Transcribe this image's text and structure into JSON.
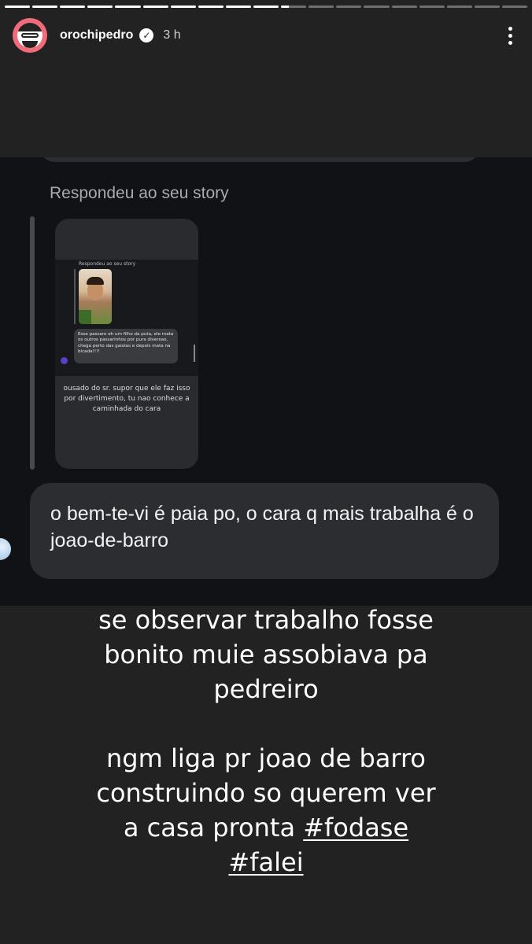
{
  "progress": {
    "segments": 19,
    "completed": 10,
    "current_fill": 0.3
  },
  "header": {
    "username": "orochipedro",
    "verified_icon": "verified-badge-icon",
    "time": "3 h"
  },
  "panel": {
    "replied_label": "Respondeu ao seu story",
    "thumbnail": {
      "replied_label": "Respondeu ao seu story",
      "message": "Esse passaro eh um filho da puta, ele mata os outros passarinhos por pura diversao, chega perto das gaiolas e depois mata na bicada!!!!",
      "caption": "ousado do sr. supor que ele faz isso por divertimento, tu nao conhece a caminhada do cara"
    },
    "reply": "o bem-te-vi é paia po, o cara q mais trabalha é o joao-de-barro"
  },
  "caption": {
    "line1": "se observar trabalho fosse",
    "line2": "bonito muie assobiava pa",
    "line3": "pedreiro",
    "line4": "ngm liga pr joao de barro",
    "line5": "construindo so querem ver",
    "line6_prefix": "a casa pronta ",
    "hashtag1": "#fodase",
    "hashtag2": "#falei"
  },
  "colors": {
    "background": "#222222",
    "panel": "#101216",
    "bubble": "#2c2d30",
    "avatar_ring": "#f26b7a"
  }
}
